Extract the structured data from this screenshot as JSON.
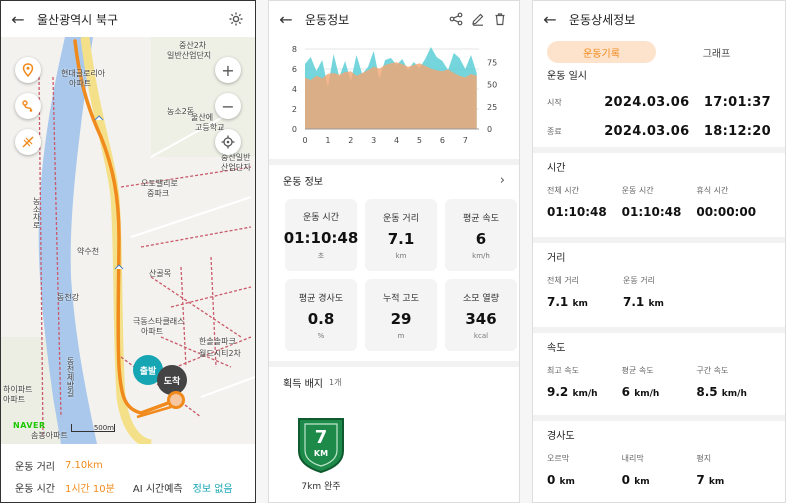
{
  "map_screen": {
    "title": "울산광역시 북구",
    "labels": {
      "apt1": "현대글로리아",
      "apt1b": "아파트",
      "dist_a": "중산2차",
      "dist_b": "일반산업단지",
      "school_a": "농소2동",
      "school_b": "울산에",
      "school_c": "고등학교",
      "center_a": "중산일반",
      "center_b": "산업단지",
      "mall_a": "오토밸리로",
      "mall_b": "중파크",
      "stream": "약수천",
      "shop": "산골목",
      "dongcheon": "동천강",
      "apt2a": "극동스타클래스",
      "apt2b": "아파트",
      "city_a": "한솔솔파크",
      "city_b": "월드시티2차",
      "bot_a": "하이파트",
      "bot_b": "아파트",
      "bot_c": "솜봉아파트",
      "road_v1": "농소차로",
      "road_v2": "동천제방길",
      "start_pin": "출발",
      "end_pin": "도착"
    },
    "naver": "NAVER",
    "scale": "500m",
    "summary": {
      "distance_label": "운동 거리",
      "distance_value": "7.10km",
      "time_label": "운동 시간",
      "time_value": "1시간 10분",
      "ai_label": "AI 시간예측",
      "ai_value": "정보 없음"
    }
  },
  "info_screen": {
    "title": "운동정보",
    "section_title": "운동 정보",
    "cards": [
      {
        "title": "운동 시간",
        "value": "01:10:48",
        "unit": "초"
      },
      {
        "title": "운동 거리",
        "value": "7.1",
        "unit": "km"
      },
      {
        "title": "평균 속도",
        "value": "6",
        "unit": "km/h"
      },
      {
        "title": "평균 경사도",
        "value": "0.8",
        "unit": "%"
      },
      {
        "title": "누적 고도",
        "value": "29",
        "unit": "m"
      },
      {
        "title": "소모 열량",
        "value": "346",
        "unit": "kcal"
      }
    ],
    "badge_title": "획득 배지",
    "badge_count": "1개",
    "badge_label": "7km 완주",
    "badge_num": "7",
    "badge_text": "KM"
  },
  "detail_screen": {
    "title": "운동상세정보",
    "tabs": [
      "운동기록",
      "그래프"
    ],
    "datetime": {
      "title": "운동 일시",
      "start_label": "시작",
      "start_value": "2024.03.06   17:01:37",
      "end_label": "종료",
      "end_value": "2024.03.06   18:12:20"
    },
    "time": {
      "title": "시간",
      "items": [
        {
          "label": "전체 시간",
          "value": "01:10:48"
        },
        {
          "label": "운동 시간",
          "value": "01:10:48"
        },
        {
          "label": "휴식 시간",
          "value": "00:00:00"
        }
      ]
    },
    "distance": {
      "title": "거리",
      "items": [
        {
          "label": "전체 거리",
          "value": "7.1",
          "unit": "km"
        },
        {
          "label": "운동 거리",
          "value": "7.1",
          "unit": "km"
        }
      ]
    },
    "speed": {
      "title": "속도",
      "items": [
        {
          "label": "최고 속도",
          "value": "9.2",
          "unit": "km/h"
        },
        {
          "label": "평균 속도",
          "value": "6",
          "unit": "km/h"
        },
        {
          "label": "구간 속도",
          "value": "8.5",
          "unit": "km/h"
        }
      ]
    },
    "slope": {
      "title": "경사도",
      "items": [
        {
          "label": "오르막",
          "value": "0",
          "unit": "km"
        },
        {
          "label": "내리막",
          "value": "0",
          "unit": "km"
        },
        {
          "label": "평지",
          "value": "7",
          "unit": "km"
        }
      ]
    }
  },
  "chart_data": {
    "type": "area",
    "x": [
      0,
      0.25,
      0.5,
      0.75,
      1,
      1.25,
      1.5,
      1.75,
      2,
      2.25,
      2.5,
      2.75,
      3,
      3.25,
      3.5,
      3.75,
      4,
      4.25,
      4.5,
      4.75,
      5,
      5.25,
      5.5,
      5.75,
      6,
      6.25,
      6.5,
      6.75,
      7,
      7.25,
      7.5
    ],
    "xticks": [
      0,
      1,
      2,
      3,
      4,
      5,
      6,
      7
    ],
    "xlim": [
      0,
      7.6
    ],
    "left_axis": {
      "ticks": [
        0,
        2,
        4,
        6,
        8
      ],
      "ylim": [
        0,
        8
      ]
    },
    "right_axis": {
      "ticks": [
        0,
        25,
        50,
        75
      ],
      "ylim": [
        0,
        90
      ]
    },
    "series": [
      {
        "color": "#5ccfd6",
        "axis": "left",
        "values": [
          6.5,
          7.2,
          5.8,
          6.9,
          4.2,
          7.5,
          5.2,
          6.8,
          4.8,
          7.4,
          5.5,
          6.2,
          7.8,
          5.0,
          6.9,
          7.1,
          6.4,
          7.0,
          5.9,
          6.7,
          6.1,
          7.0,
          8.2,
          7.2,
          6.8,
          5.9,
          7.6,
          7.1,
          6.0,
          7.4,
          5.6
        ]
      },
      {
        "color": "#f4a572",
        "axis": "right",
        "values": [
          58,
          55,
          60,
          57,
          62,
          63,
          61,
          64,
          65,
          60,
          63,
          66,
          70,
          68,
          72,
          74,
          75,
          73,
          70,
          72,
          74,
          71,
          68,
          66,
          65,
          67,
          63,
          60,
          58,
          62,
          60
        ]
      }
    ]
  },
  "colors": {
    "accent": "#f08a1c",
    "teal": "#16a5b3",
    "route": "#f08a1c",
    "badge": "#1e8a4a"
  }
}
